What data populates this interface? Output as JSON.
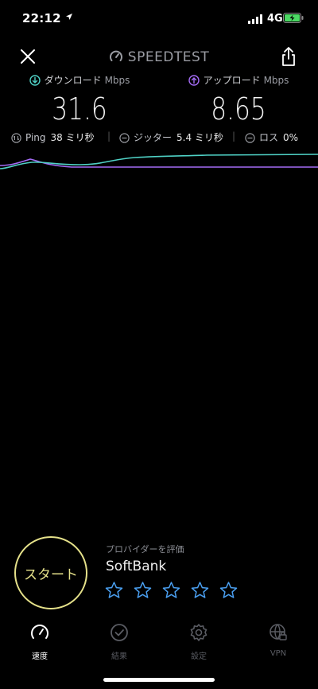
{
  "status_bar": {
    "time": "22:12",
    "network": "4G"
  },
  "app": {
    "title": "SPEEDTEST"
  },
  "download": {
    "label": "ダウンロード",
    "unit": "Mbps",
    "value": "31.6",
    "color": "#4fd1c5"
  },
  "upload": {
    "label": "アップロード",
    "unit": "Mbps",
    "value": "8.65",
    "color": "#a46bf5"
  },
  "stats": {
    "ping": {
      "label": "Ping",
      "value": "38 ミリ秒"
    },
    "jitter": {
      "label": "ジッター",
      "value": "5.4 ミリ秒"
    },
    "loss": {
      "label": "ロス",
      "value": "0%"
    }
  },
  "start_button": {
    "label": "スタート",
    "color": "#e5e18a"
  },
  "provider": {
    "caption": "プロバイダーを評価",
    "name": "SoftBank",
    "rating_max": 5,
    "star_color": "#4a9ff0"
  },
  "tabs": [
    {
      "label": "速度",
      "icon": "gauge-icon",
      "active": true
    },
    {
      "label": "結果",
      "icon": "check-circle-icon",
      "active": false
    },
    {
      "label": "設定",
      "icon": "gear-icon",
      "active": false
    },
    {
      "label": "VPN",
      "icon": "globe-lock-icon",
      "active": false
    }
  ]
}
